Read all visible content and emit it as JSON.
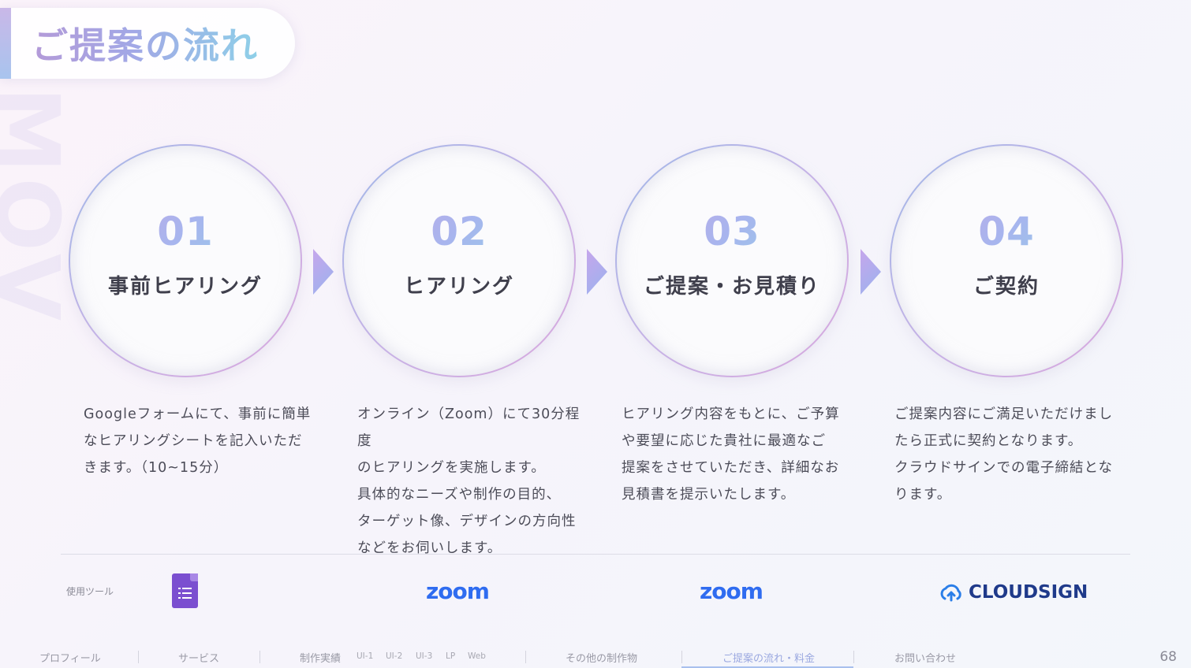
{
  "title": "ご提案の流れ",
  "steps": [
    {
      "num": "01",
      "name": "事前ヒアリング",
      "desc": [
        "Googleフォームにて、事前に簡単",
        "なヒアリングシートを記入いただ",
        "きます。（10~15分）"
      ]
    },
    {
      "num": "02",
      "name": "ヒアリング",
      "desc": [
        "オンライン（Zoom）にて30分程度",
        "のヒアリングを実施します。",
        "具体的なニーズや制作の目的、",
        "ターゲット像、デザインの方向性",
        "などをお伺いします。"
      ]
    },
    {
      "num": "03",
      "name": "ご提案・お見積り",
      "desc": [
        "ヒアリング内容をもとに、ご予算",
        "や要望に応じた貴社に最適なご",
        "提案をさせていただき、詳細なお",
        "見積書を提示いたします。"
      ]
    },
    {
      "num": "04",
      "name": "ご契約",
      "desc": [
        "ご提案内容にご満足いただけまし",
        "たら正式に契約となります。",
        "クラウドサインでの電子締結とな",
        "ります。"
      ]
    }
  ],
  "tools": {
    "label": "使用ツール",
    "items": [
      {
        "icon": "google-forms-icon"
      },
      {
        "text": "zoom"
      },
      {
        "text": "zoom"
      },
      {
        "icon": "cloudsign-logo-icon",
        "text": "CLOUDSIGN"
      }
    ]
  },
  "nav": {
    "items": [
      "プロフィール",
      "サービス",
      "制作実績",
      "UI-1",
      "UI-2",
      "UI-3",
      "LP",
      "Web",
      "その他の制作物",
      "ご提案の流れ・料金",
      "お問い合わせ"
    ],
    "active": "ご提案の流れ・料金"
  },
  "page_number": "68",
  "colors": {
    "accent": "#2f6cf0",
    "gradient_start": "#c9a8e4",
    "gradient_end": "#8ed8e4"
  }
}
